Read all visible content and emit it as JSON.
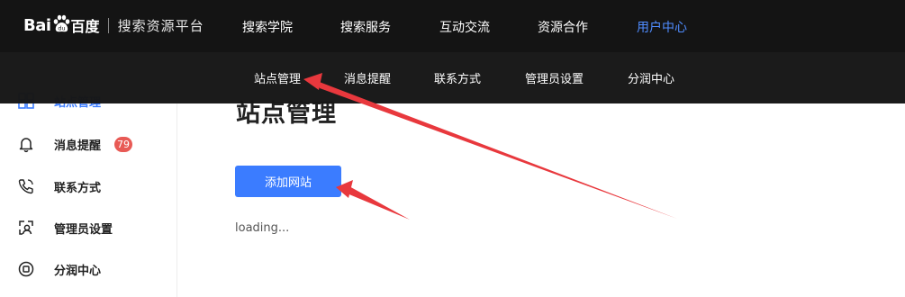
{
  "brand": {
    "logo_text": "Bai",
    "logo_du": "百度",
    "subtitle": "搜索资源平台"
  },
  "top_nav": {
    "items": [
      "搜索学院",
      "搜索服务",
      "互动交流",
      "资源合作",
      "用户中心"
    ],
    "active": "用户中心"
  },
  "sub_nav": {
    "items": [
      "站点管理",
      "消息提醒",
      "联系方式",
      "管理员设置",
      "分润中心"
    ]
  },
  "sidebar": {
    "items": [
      {
        "label": "站点管理",
        "icon": "site-management-icon",
        "active": true
      },
      {
        "label": "消息提醒",
        "icon": "bell-icon",
        "badge": "79"
      },
      {
        "label": "联系方式",
        "icon": "phone-icon"
      },
      {
        "label": "管理员设置",
        "icon": "admin-settings-icon"
      },
      {
        "label": "分润中心",
        "icon": "revenue-share-icon"
      }
    ]
  },
  "main": {
    "title": "站点管理",
    "add_site_label": "添加网站",
    "loading_text": "loading..."
  },
  "colors": {
    "accent": "#3b7cff",
    "badge": "#e85a55",
    "topbar": "#141414",
    "arrow": "#e8383d"
  }
}
